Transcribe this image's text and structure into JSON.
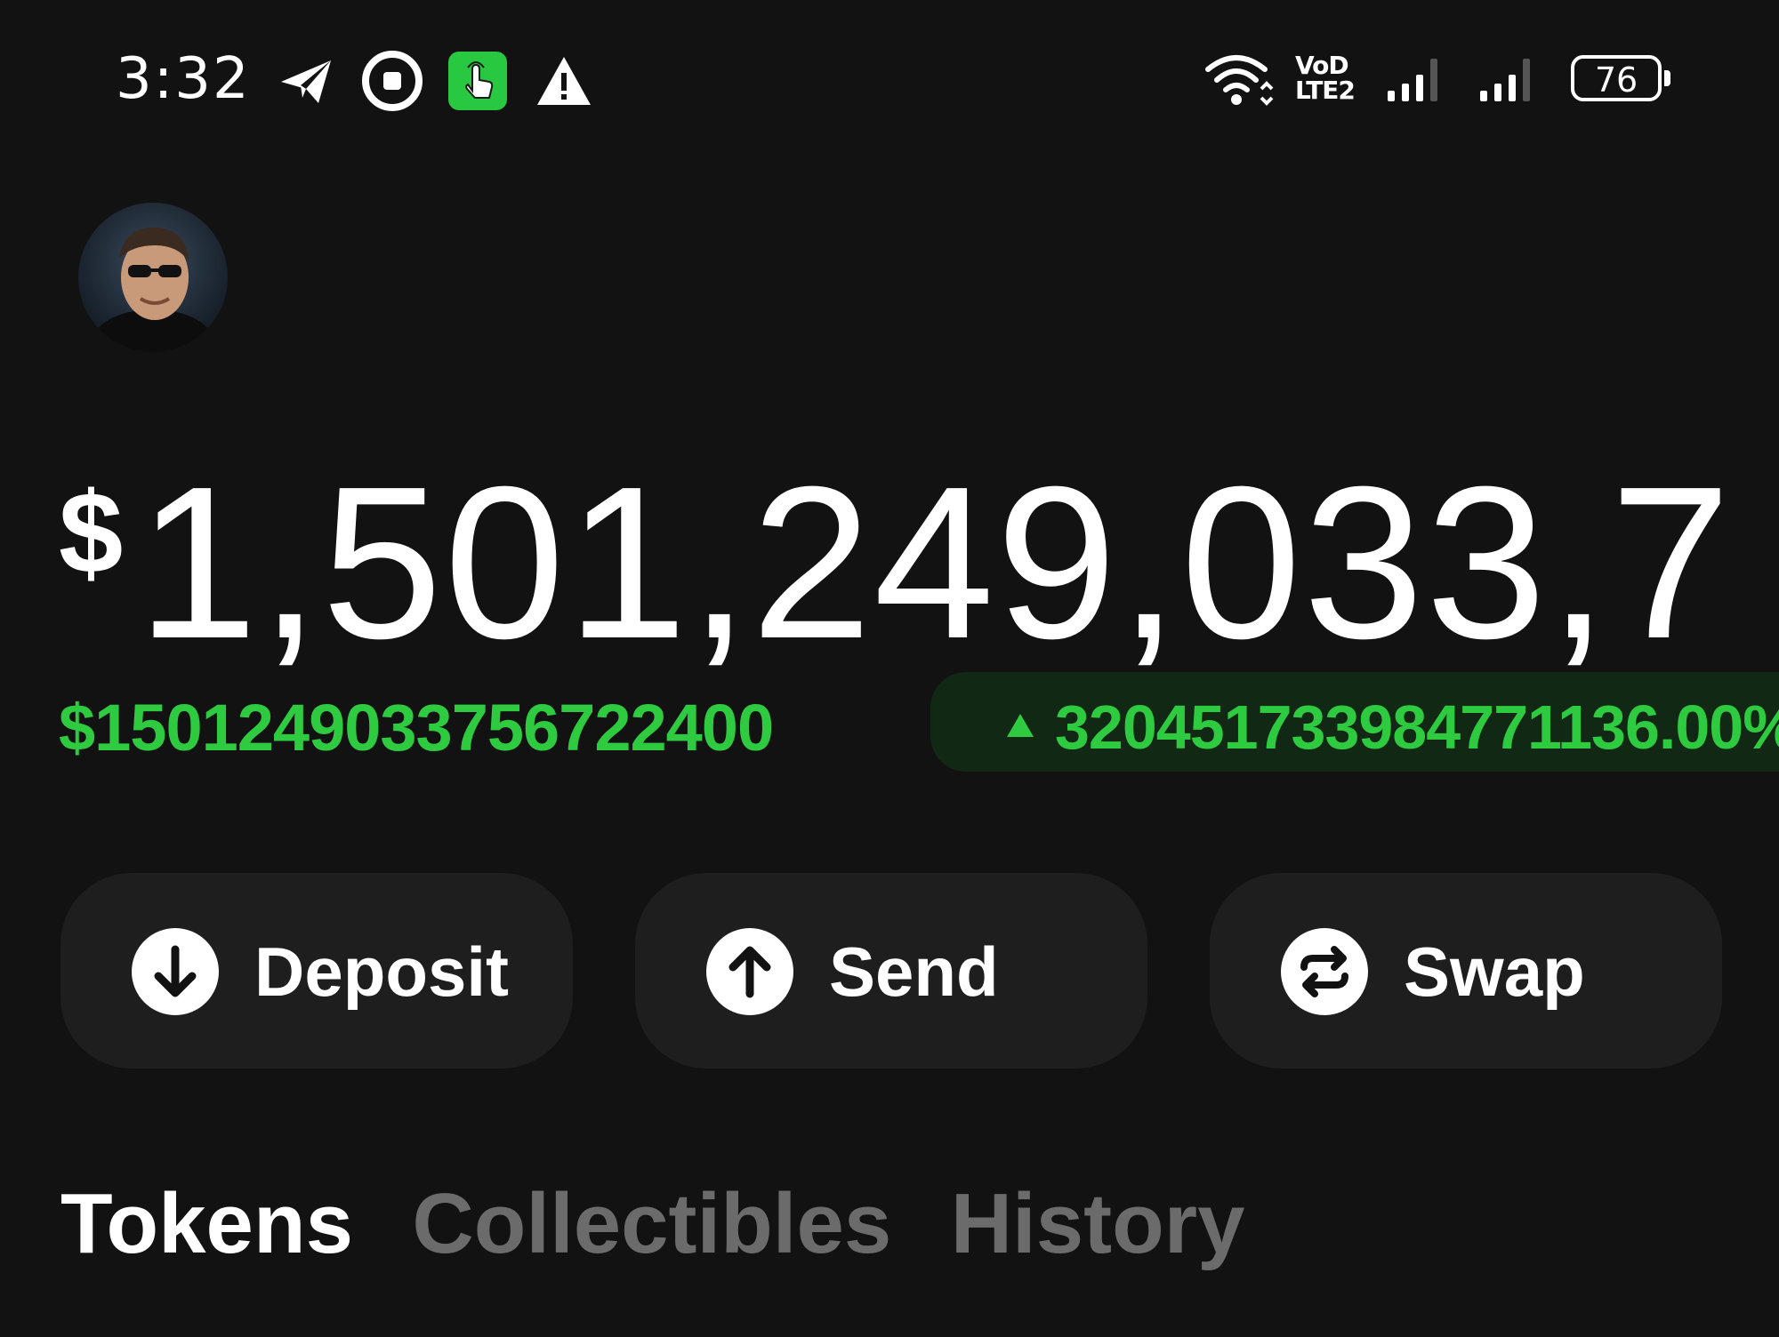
{
  "status_bar": {
    "time": "3:32",
    "volte_line1": "VoD",
    "volte_line2": "LTE2",
    "battery_level": "76",
    "icons": [
      "telegram-icon",
      "record-icon",
      "touch-icon",
      "warning-icon",
      "wifi-icon",
      "volte-icon",
      "signal-icon",
      "signal-icon",
      "battery-icon"
    ]
  },
  "profile": {
    "avatar_icon": "avatar"
  },
  "balance": {
    "currency_symbol": "$",
    "amount": "1,501,249,033,7",
    "change_amount": "$1501249033756722400",
    "change_percent": "32045173398477113​6.00%"
  },
  "actions": {
    "deposit_label": "Deposit",
    "send_label": "Send",
    "swap_label": "Swap"
  },
  "tabs": {
    "tokens_label": "Tokens",
    "collectibles_label": "Collectibles",
    "history_label": "History",
    "active": "Tokens"
  },
  "colors": {
    "background": "#121212",
    "positive": "#2ecb40",
    "positive_bg": "#112814",
    "button_bg": "#1e1e1e",
    "inactive_tab": "#6b6b6b"
  }
}
